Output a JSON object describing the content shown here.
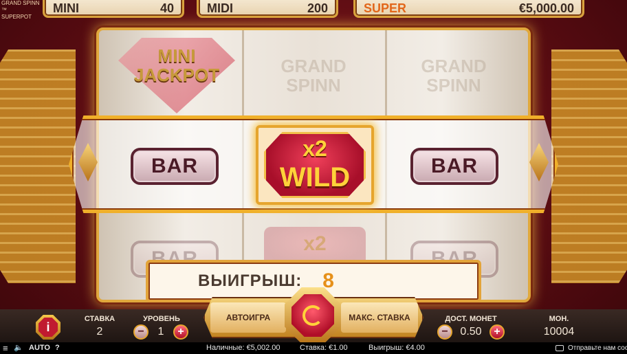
{
  "game": {
    "logo_line1": "GRAND SPINN ™",
    "logo_line2": "SUPERPOT"
  },
  "jackpots": {
    "mini": {
      "label": "MINI",
      "value": "40"
    },
    "midi": {
      "label": "MIDI",
      "value": "200"
    },
    "super": {
      "label": "SUPER",
      "value": "€5,000.00"
    }
  },
  "reels": {
    "top_left": {
      "line1": "MINI",
      "line2": "JACKPOT"
    },
    "top_middle": {
      "line1": "GRAND",
      "line2": "SPINN"
    },
    "top_right": {
      "line1": "GRAND",
      "line2": "SPINN"
    },
    "left_symbol": "BAR",
    "wild_multiplier": "x2",
    "wild_label": "WILD",
    "right_symbol": "BAR",
    "ghost_bar_left": "BAR",
    "ghost_wild": "x2",
    "ghost_bar_right": "BAR"
  },
  "win": {
    "label": "ВЫИГРЫШ:",
    "value": "8"
  },
  "controls": {
    "bet_label": "СТАВКА",
    "bet_value": "2",
    "level_label": "УРОВЕНЬ",
    "level_value": "1",
    "minus_symbol": "−",
    "plus_symbol": "+",
    "autoplay_label": "АВТОИГРА",
    "max_bet_label": "МАКС. СТАВКА",
    "coin_value_label": "ДОСТ. МОНЕТ",
    "coin_value": "0.50",
    "coins_label": "МОН.",
    "coins_value": "10004",
    "info_label": "i"
  },
  "status_bar": {
    "auto_label": "AUTO",
    "help_label": "?",
    "cash": "Наличные: €5,002.00",
    "stake": "Ставка: €1.00",
    "winnings": "Выигрыш: €4.00",
    "feedback": "Отправьте нам сообщ"
  },
  "colors": {
    "accent_gold": "#e0a83c",
    "wild_red": "#c01a30",
    "win_orange": "#e6901a"
  }
}
